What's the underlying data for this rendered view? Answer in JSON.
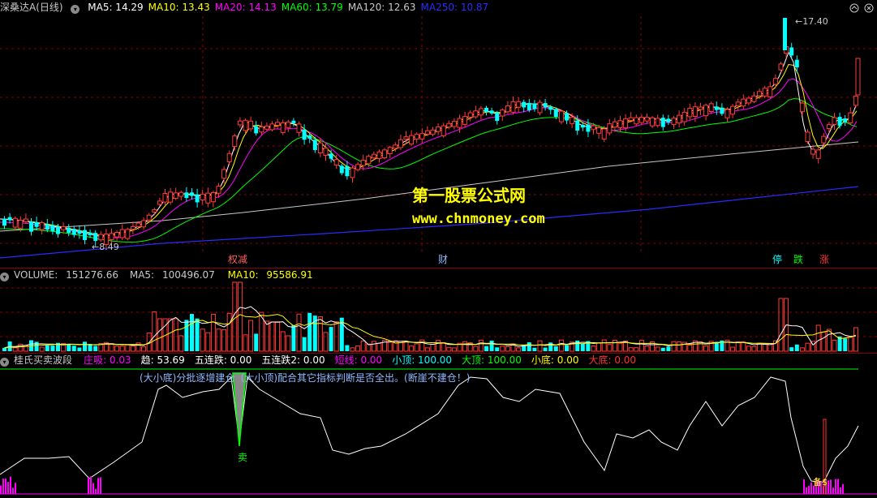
{
  "main": {
    "stock_name": "深桑达A",
    "period": "(日线)",
    "ma": [
      {
        "label": "MA5:",
        "value": "14.29",
        "color": "#ffffff"
      },
      {
        "label": "MA10:",
        "value": "13.43",
        "color": "#ffff00"
      },
      {
        "label": "MA20:",
        "value": "14.13",
        "color": "#ff00ff"
      },
      {
        "label": "MA60:",
        "value": "13.79",
        "color": "#00ff00"
      },
      {
        "label": "MA120:",
        "value": "12.63",
        "color": "#c8c8c8"
      },
      {
        "label": "MA250:",
        "value": "10.87",
        "color": "#2b2bff"
      }
    ],
    "max_label": "17.40",
    "min_label": "8.49",
    "watermark_title": "第一股票公式网",
    "watermark_url": "www.chnmoney.com",
    "events": [
      {
        "text": "权减",
        "color": "#ff6060"
      },
      {
        "text": "财",
        "color": "#8fb8ff"
      },
      {
        "text": "停",
        "color": "#00ffff"
      },
      {
        "text": "跌",
        "color": "#00ff00"
      },
      {
        "text": "涨",
        "color": "#ff3030"
      }
    ]
  },
  "volume": {
    "label": "VOLUME:",
    "value": "151276.66",
    "ma5_label": "MA5:",
    "ma5_value": "100496.07",
    "ma10_label": "MA10:",
    "ma10_value": "95586.91"
  },
  "indicator": {
    "name": "桂氏买卖波段",
    "fields": [
      {
        "label": "庄吸:",
        "value": "0.03",
        "color": "#ff00ff"
      },
      {
        "label": "趋:",
        "value": "53.69",
        "color": "#ffffff"
      },
      {
        "label": "五连跌:",
        "value": "0.00",
        "color": "#ffffff"
      },
      {
        "label": "五连跌2:",
        "value": "0.00",
        "color": "#ffffff"
      },
      {
        "label": "短线:",
        "value": "0.00",
        "color": "#ff00ff"
      },
      {
        "label": "小顶:",
        "value": "100.00",
        "color": "#00ffff"
      },
      {
        "label": "大顶:",
        "value": "100.00",
        "color": "#00ff00"
      },
      {
        "label": "小底:",
        "value": "0.00",
        "color": "#ffff00"
      },
      {
        "label": "大底:",
        "value": "0.00",
        "color": "#ff3030"
      }
    ],
    "note": "(大小底)分批逐增建仓（大小顶)配合其它指标判断是否全出。(断崖不建仓！)",
    "sell_label": "卖",
    "mid_label": "备$"
  },
  "colors": {
    "up": "#ff3b3b",
    "down": "#00ffff",
    "grid": "#8b0000",
    "ma5": "#ffffff",
    "ma10": "#ffff00",
    "ma20": "#ff00ff",
    "ma60": "#00ff00",
    "ma120": "#c8c8c8",
    "ma250": "#2b2bff"
  }
}
